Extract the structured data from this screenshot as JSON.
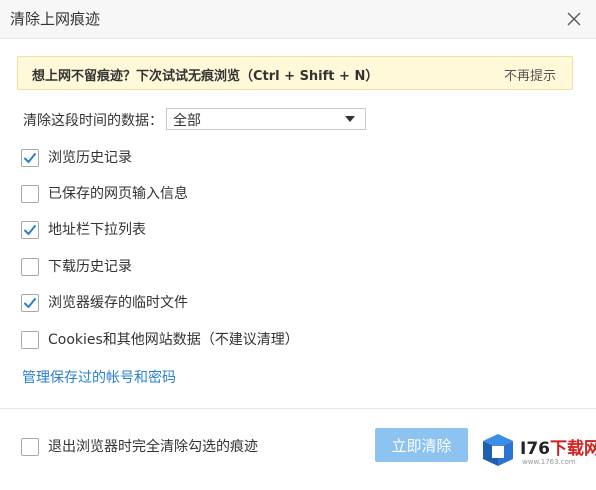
{
  "dialog": {
    "title": "清除上网痕迹"
  },
  "notice": {
    "text": "想上网不留痕迹？下次试试无痕浏览（Ctrl + Shift + N）",
    "dismiss_label": "不再提示"
  },
  "time_range": {
    "label": "清除这段时间的数据：",
    "selected": "全部"
  },
  "options": [
    {
      "label": "浏览历史记录",
      "checked": true
    },
    {
      "label": "已保存的网页输入信息",
      "checked": false
    },
    {
      "label": "地址栏下拉列表",
      "checked": true
    },
    {
      "label": "下载历史记录",
      "checked": false
    },
    {
      "label": "浏览器缓存的临时文件",
      "checked": true
    },
    {
      "label": "Cookies和其他网站数据（不建议清理）",
      "checked": false
    }
  ],
  "manage_link": "管理保存过的帐号和密码",
  "footer": {
    "exit_clear_label": "退出浏览器时完全清除勾选的痕迹",
    "exit_clear_checked": false,
    "clear_button": "立即清除"
  },
  "watermark": {
    "brand_prefix": "I76",
    "brand_suffix": "下载网",
    "url": "www.1763.com"
  },
  "colors": {
    "accent": "#2a7fcf",
    "button": "#8dc3f1",
    "notice_bg": "#fff8d9"
  }
}
